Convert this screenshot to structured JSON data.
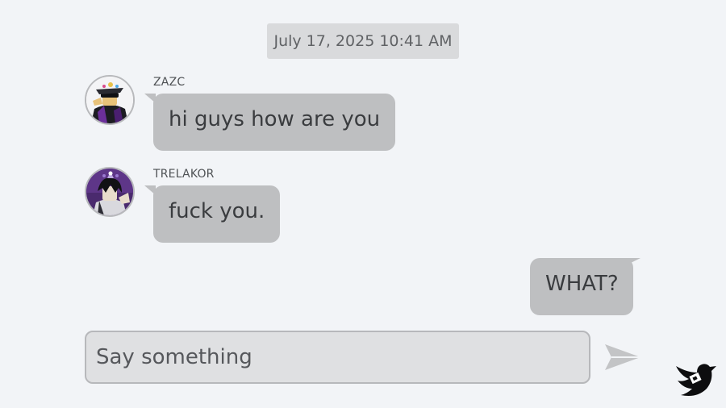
{
  "chat": {
    "timestamp": "July 17, 2025 10:41 AM",
    "messages": [
      {
        "sender": "ZAZC",
        "text": "hi guys how are you",
        "avatar_icon": "avatar-zazc-icon"
      },
      {
        "sender": "TRELAKOR",
        "text": "fuck you.",
        "avatar_icon": "avatar-trelakor-icon"
      },
      {
        "sender": "",
        "text": "WHAT?",
        "outgoing": true
      }
    ]
  },
  "composer": {
    "placeholder": "Say something",
    "send_icon": "send-icon"
  },
  "branding": {
    "logo_icon": "bird-logo-icon"
  },
  "colors": {
    "background": "#f2f4f7",
    "bubble": "#bebfc1",
    "timestamp_bg": "#d9dadc",
    "input_bg": "#dfe0e2",
    "text": "#3a3c3f"
  }
}
